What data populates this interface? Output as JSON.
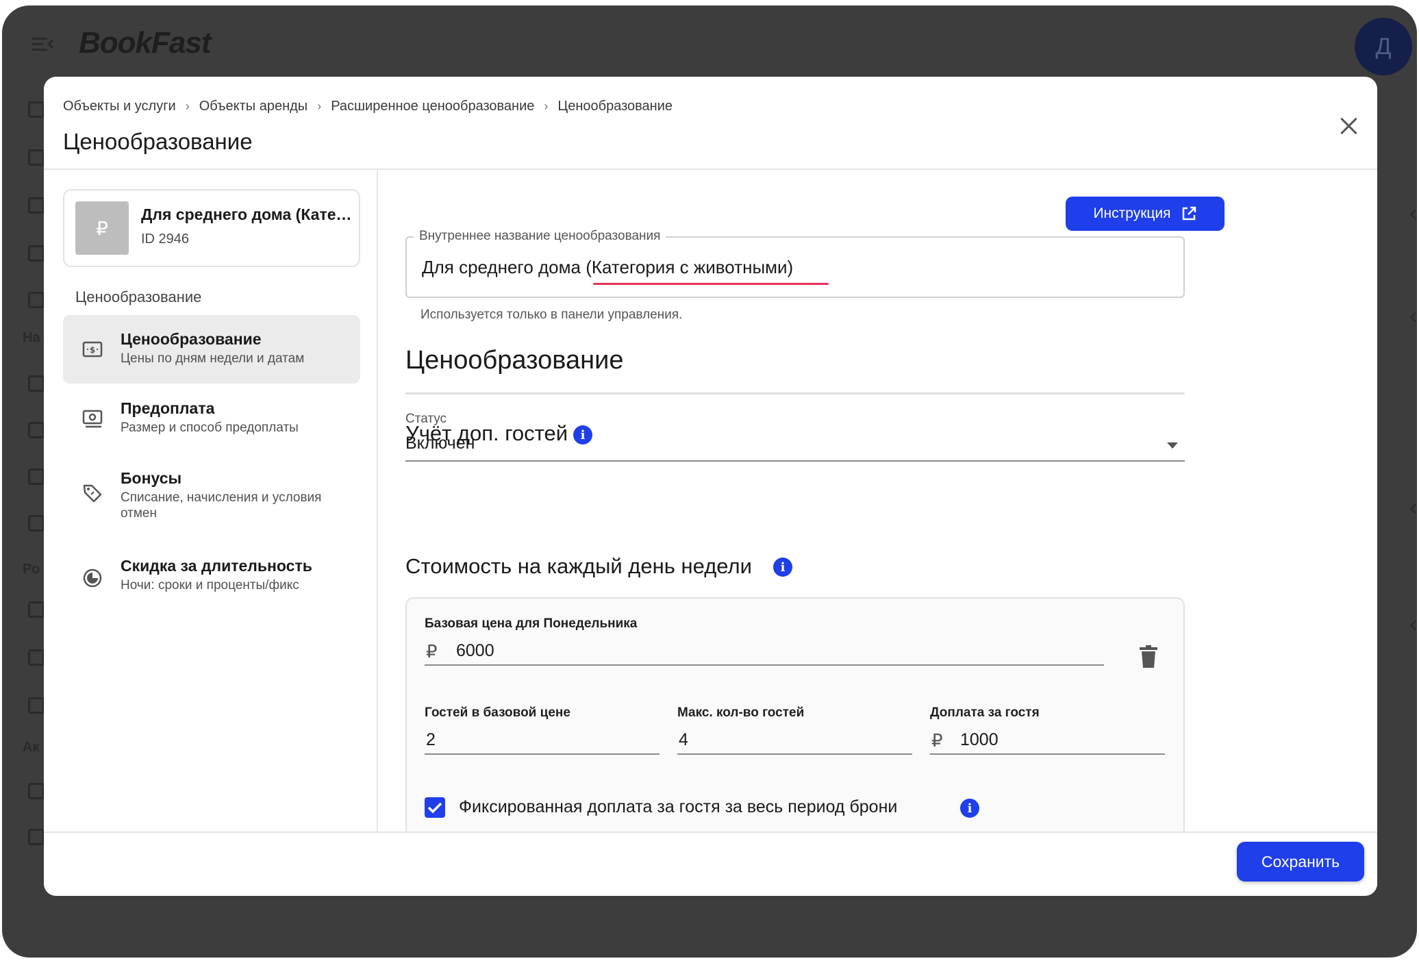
{
  "app": {
    "logo": "BookFast",
    "avatar_initial": "Д",
    "bg_sidebar_fragments": [
      "На",
      "Ро",
      "Ак"
    ]
  },
  "modal": {
    "breadcrumb": [
      "Объекты и услуги",
      "Объекты аренды",
      "Расширенное ценообразование",
      "Ценообразование"
    ],
    "title": "Ценообразование"
  },
  "sidebar": {
    "property": {
      "thumb_symbol": "₽",
      "name": "Для среднего дома (Категория с животными)",
      "id": "ID 2946"
    },
    "section_label": "Ценообразование",
    "items": [
      {
        "title": "Ценообразование",
        "subtitle": "Цены по дням недели и датам",
        "icon": "price-tag-icon",
        "active": true
      },
      {
        "title": "Предоплата",
        "subtitle": "Размер и способ предоплаты",
        "icon": "cash-icon",
        "active": false
      },
      {
        "title": "Бонусы",
        "subtitle": "Списание, начисления и условия отмен",
        "icon": "bonus-tag-icon",
        "active": false
      },
      {
        "title": "Скидка за длительность",
        "subtitle": "Ночи: сроки и проценты/фикс",
        "icon": "pie-chart-icon",
        "active": false
      }
    ]
  },
  "main": {
    "instruction_button": "Инструкция",
    "internal_name": {
      "label": "Внутреннее название ценообразования",
      "value": "Для среднего дома (Категория с животными)",
      "helper": "Используется только в панели управления."
    },
    "pricing_heading": "Ценообразование",
    "extra_guests": {
      "heading": "Учёт доп. гостей",
      "status_label": "Статус",
      "status_value": "Включен"
    },
    "weekday_cost": {
      "heading": "Стоимость на каждый день недели",
      "base_price_label": "Базовая цена для Понедельника",
      "currency": "₽",
      "base_price": "6000",
      "guests_in_base_label": "Гостей в базовой цене",
      "guests_in_base": "2",
      "max_guests_label": "Макс. кол-во гостей",
      "max_guests": "4",
      "extra_fee_label": "Доплата за гостя",
      "extra_fee": "1000",
      "fixed_fee_label": "Фиксированная доплата за гостя за весь период брони",
      "fixed_fee_checked": true
    }
  },
  "footer": {
    "save_button": "Сохранить"
  },
  "colors": {
    "accent": "#1f3fea",
    "spell_error": "#e6305a",
    "backdrop": "#3d3d3d"
  }
}
